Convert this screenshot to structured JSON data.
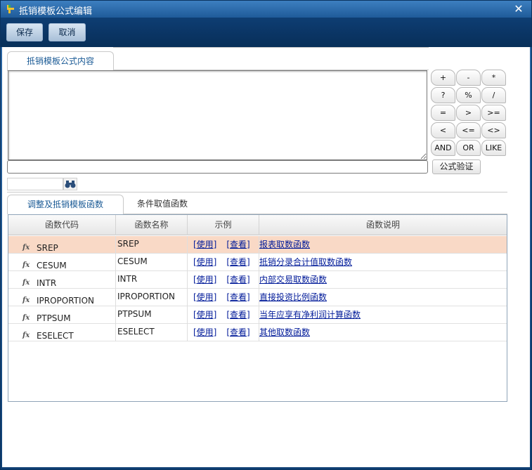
{
  "window": {
    "title": "抵销模板公式编辑",
    "close_glyph": "✕"
  },
  "toolbar": {
    "save_label": "保存",
    "cancel_label": "取消"
  },
  "formula_tab": {
    "label": "抵销模板公式内容"
  },
  "operators": [
    "+",
    "-",
    "*",
    "?",
    "%",
    "/",
    "=",
    ">",
    ">=",
    "<",
    "<=",
    "<>",
    "AND",
    "OR",
    "LIKE"
  ],
  "verify_label": "公式验证",
  "func_tabs": [
    {
      "label": "调整及抵销模板函数",
      "active": true
    },
    {
      "label": "条件取值函数",
      "active": false
    }
  ],
  "grid": {
    "headers": [
      "函数代码",
      "函数名称",
      "示例",
      "函数说明"
    ],
    "use_label": "[使用]",
    "view_label": "[查看]",
    "rows": [
      {
        "code": "SREP",
        "name": "SREP",
        "desc": "报表取数函数",
        "selected": true
      },
      {
        "code": "CESUM",
        "name": "CESUM",
        "desc": "抵销分录合计值取数函数"
      },
      {
        "code": "INTR",
        "name": "INTR",
        "desc": "内部交易取数函数"
      },
      {
        "code": "IPROPORTION",
        "name": "IPROPORTION",
        "desc": "直接投资比例函数"
      },
      {
        "code": "PTPSUM",
        "name": "PTPSUM",
        "desc": "当年应享有净利润计算函数"
      },
      {
        "code": "ESELECT",
        "name": "ESELECT",
        "desc": "其他取数函数"
      }
    ]
  },
  "colors": {
    "selected_row": "#f9d9c6",
    "toolbar": "#0a3463",
    "link": "#001a99"
  },
  "icons": {
    "app": "app-logo-icon",
    "search": "binoculars-icon",
    "function": "fx-icon"
  }
}
